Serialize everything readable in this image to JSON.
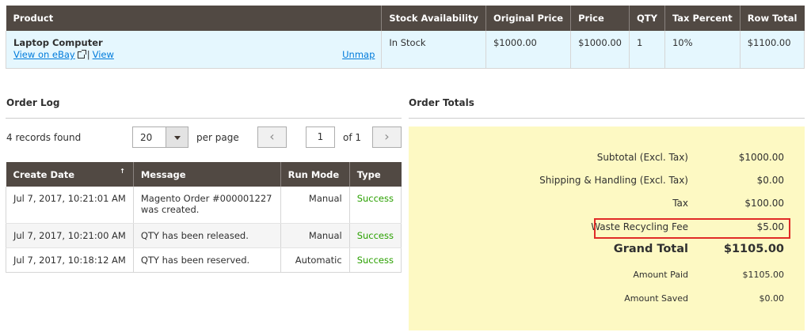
{
  "items_table": {
    "headers": {
      "product": "Product",
      "stock": "Stock Availability",
      "original_price": "Original Price",
      "price": "Price",
      "qty": "QTY",
      "tax_percent": "Tax Percent",
      "row_total": "Row Total"
    },
    "row": {
      "product_name": "Laptop Computer",
      "view_ebay": "View on eBay",
      "separator": "|",
      "view": "View",
      "unmap": "Unmap",
      "stock": "In Stock",
      "original_price": "$1000.00",
      "price": "$1000.00",
      "qty": "1",
      "tax_percent": "10%",
      "row_total": "$1100.00"
    }
  },
  "order_log": {
    "title": "Order Log",
    "records_found": "4 records found",
    "per_page_value": "20",
    "per_page_label": "per page",
    "prev_glyph": "‹",
    "next_glyph": "›",
    "current_page": "1",
    "of_pages": "of 1",
    "headers": {
      "create_date": "Create Date",
      "sort_glyph": "↑",
      "message": "Message",
      "run_mode": "Run Mode",
      "type": "Type"
    },
    "rows": [
      {
        "date": "Jul 7, 2017, 10:21:01 AM",
        "message": "Magento Order #000001227 was created.",
        "run_mode": "Manual",
        "type": "Success"
      },
      {
        "date": "Jul 7, 2017, 10:21:00 AM",
        "message": "QTY has been released.",
        "run_mode": "Manual",
        "type": "Success"
      },
      {
        "date": "Jul 7, 2017, 10:18:12 AM",
        "message": "QTY has been reserved.",
        "run_mode": "Automatic",
        "type": "Success"
      }
    ]
  },
  "order_totals": {
    "title": "Order Totals",
    "subtotal_label": "Subtotal (Excl. Tax)",
    "subtotal_value": "$1000.00",
    "shipping_label": "Shipping & Handling (Excl. Tax)",
    "shipping_value": "$0.00",
    "tax_label": "Tax",
    "tax_value": "$100.00",
    "waste_label": "Waste Recycling Fee",
    "waste_value": "$5.00",
    "grand_label": "Grand Total",
    "grand_value": "$1105.00",
    "paid_label": "Amount Paid",
    "paid_value": "$1105.00",
    "saved_label": "Amount Saved",
    "saved_value": "$0.00"
  },
  "colors": {
    "header_bg": "#514943",
    "row_highlight_bg": "#e5f7fe",
    "totals_bg": "#fdf9c3",
    "link": "#007bdb",
    "success": "#2aa000",
    "annotation_box": "#e02b27"
  }
}
